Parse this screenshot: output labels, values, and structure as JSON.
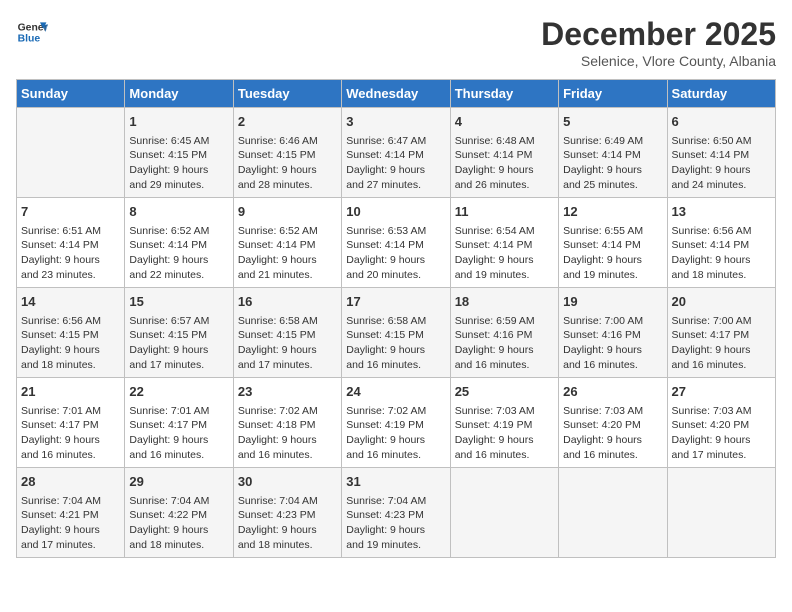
{
  "logo": {
    "text_general": "General",
    "text_blue": "Blue"
  },
  "title": "December 2025",
  "subtitle": "Selenice, Vlore County, Albania",
  "days_of_week": [
    "Sunday",
    "Monday",
    "Tuesday",
    "Wednesday",
    "Thursday",
    "Friday",
    "Saturday"
  ],
  "weeks": [
    [
      {
        "day": "",
        "content": ""
      },
      {
        "day": "1",
        "content": "Sunrise: 6:45 AM\nSunset: 4:15 PM\nDaylight: 9 hours\nand 29 minutes."
      },
      {
        "day": "2",
        "content": "Sunrise: 6:46 AM\nSunset: 4:15 PM\nDaylight: 9 hours\nand 28 minutes."
      },
      {
        "day": "3",
        "content": "Sunrise: 6:47 AM\nSunset: 4:14 PM\nDaylight: 9 hours\nand 27 minutes."
      },
      {
        "day": "4",
        "content": "Sunrise: 6:48 AM\nSunset: 4:14 PM\nDaylight: 9 hours\nand 26 minutes."
      },
      {
        "day": "5",
        "content": "Sunrise: 6:49 AM\nSunset: 4:14 PM\nDaylight: 9 hours\nand 25 minutes."
      },
      {
        "day": "6",
        "content": "Sunrise: 6:50 AM\nSunset: 4:14 PM\nDaylight: 9 hours\nand 24 minutes."
      }
    ],
    [
      {
        "day": "7",
        "content": "Sunrise: 6:51 AM\nSunset: 4:14 PM\nDaylight: 9 hours\nand 23 minutes."
      },
      {
        "day": "8",
        "content": "Sunrise: 6:52 AM\nSunset: 4:14 PM\nDaylight: 9 hours\nand 22 minutes."
      },
      {
        "day": "9",
        "content": "Sunrise: 6:52 AM\nSunset: 4:14 PM\nDaylight: 9 hours\nand 21 minutes."
      },
      {
        "day": "10",
        "content": "Sunrise: 6:53 AM\nSunset: 4:14 PM\nDaylight: 9 hours\nand 20 minutes."
      },
      {
        "day": "11",
        "content": "Sunrise: 6:54 AM\nSunset: 4:14 PM\nDaylight: 9 hours\nand 19 minutes."
      },
      {
        "day": "12",
        "content": "Sunrise: 6:55 AM\nSunset: 4:14 PM\nDaylight: 9 hours\nand 19 minutes."
      },
      {
        "day": "13",
        "content": "Sunrise: 6:56 AM\nSunset: 4:14 PM\nDaylight: 9 hours\nand 18 minutes."
      }
    ],
    [
      {
        "day": "14",
        "content": "Sunrise: 6:56 AM\nSunset: 4:15 PM\nDaylight: 9 hours\nand 18 minutes."
      },
      {
        "day": "15",
        "content": "Sunrise: 6:57 AM\nSunset: 4:15 PM\nDaylight: 9 hours\nand 17 minutes."
      },
      {
        "day": "16",
        "content": "Sunrise: 6:58 AM\nSunset: 4:15 PM\nDaylight: 9 hours\nand 17 minutes."
      },
      {
        "day": "17",
        "content": "Sunrise: 6:58 AM\nSunset: 4:15 PM\nDaylight: 9 hours\nand 16 minutes."
      },
      {
        "day": "18",
        "content": "Sunrise: 6:59 AM\nSunset: 4:16 PM\nDaylight: 9 hours\nand 16 minutes."
      },
      {
        "day": "19",
        "content": "Sunrise: 7:00 AM\nSunset: 4:16 PM\nDaylight: 9 hours\nand 16 minutes."
      },
      {
        "day": "20",
        "content": "Sunrise: 7:00 AM\nSunset: 4:17 PM\nDaylight: 9 hours\nand 16 minutes."
      }
    ],
    [
      {
        "day": "21",
        "content": "Sunrise: 7:01 AM\nSunset: 4:17 PM\nDaylight: 9 hours\nand 16 minutes."
      },
      {
        "day": "22",
        "content": "Sunrise: 7:01 AM\nSunset: 4:17 PM\nDaylight: 9 hours\nand 16 minutes."
      },
      {
        "day": "23",
        "content": "Sunrise: 7:02 AM\nSunset: 4:18 PM\nDaylight: 9 hours\nand 16 minutes."
      },
      {
        "day": "24",
        "content": "Sunrise: 7:02 AM\nSunset: 4:19 PM\nDaylight: 9 hours\nand 16 minutes."
      },
      {
        "day": "25",
        "content": "Sunrise: 7:03 AM\nSunset: 4:19 PM\nDaylight: 9 hours\nand 16 minutes."
      },
      {
        "day": "26",
        "content": "Sunrise: 7:03 AM\nSunset: 4:20 PM\nDaylight: 9 hours\nand 16 minutes."
      },
      {
        "day": "27",
        "content": "Sunrise: 7:03 AM\nSunset: 4:20 PM\nDaylight: 9 hours\nand 17 minutes."
      }
    ],
    [
      {
        "day": "28",
        "content": "Sunrise: 7:04 AM\nSunset: 4:21 PM\nDaylight: 9 hours\nand 17 minutes."
      },
      {
        "day": "29",
        "content": "Sunrise: 7:04 AM\nSunset: 4:22 PM\nDaylight: 9 hours\nand 18 minutes."
      },
      {
        "day": "30",
        "content": "Sunrise: 7:04 AM\nSunset: 4:23 PM\nDaylight: 9 hours\nand 18 minutes."
      },
      {
        "day": "31",
        "content": "Sunrise: 7:04 AM\nSunset: 4:23 PM\nDaylight: 9 hours\nand 19 minutes."
      },
      {
        "day": "",
        "content": ""
      },
      {
        "day": "",
        "content": ""
      },
      {
        "day": "",
        "content": ""
      }
    ]
  ]
}
